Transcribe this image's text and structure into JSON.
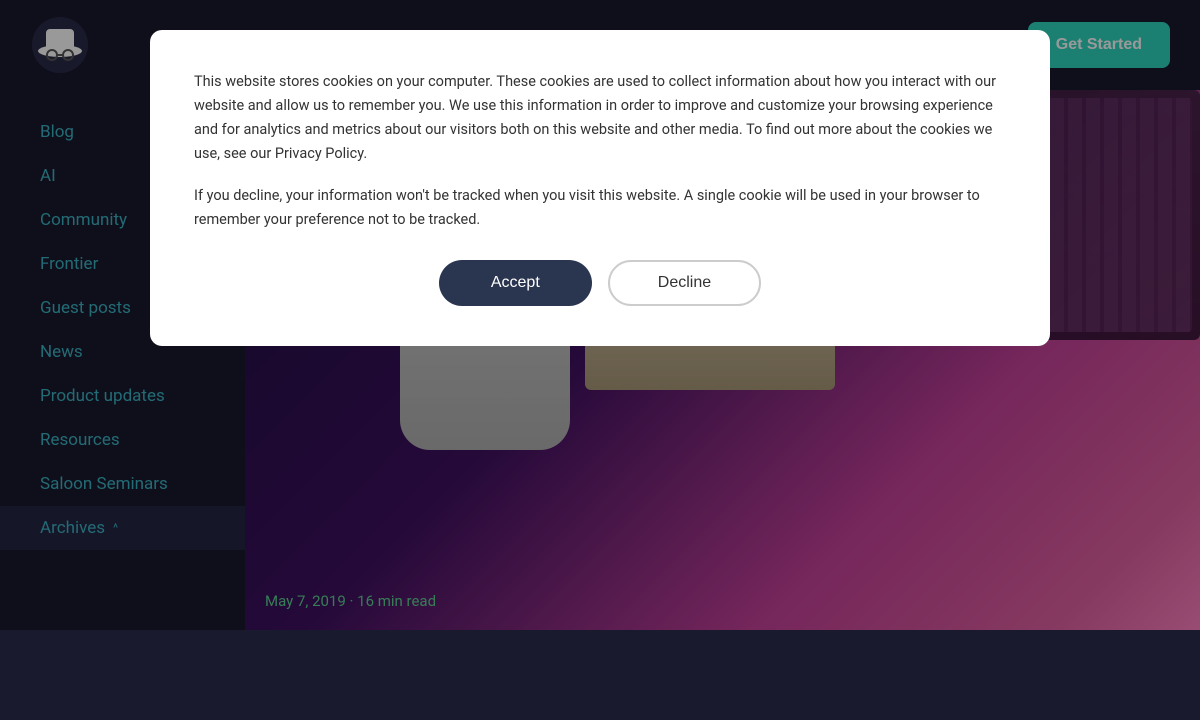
{
  "header": {
    "get_started_label": "Get Started"
  },
  "sidebar": {
    "items": [
      {
        "id": "blog",
        "label": "Blog"
      },
      {
        "id": "ai",
        "label": "AI"
      },
      {
        "id": "community",
        "label": "Community"
      },
      {
        "id": "frontier",
        "label": "Frontier"
      },
      {
        "id": "guest-posts",
        "label": "Guest posts"
      },
      {
        "id": "news",
        "label": "News"
      },
      {
        "id": "product-updates",
        "label": "Product updates"
      },
      {
        "id": "resources",
        "label": "Resources"
      },
      {
        "id": "saloon-seminars",
        "label": "Saloon Seminars"
      }
    ],
    "archives_label": "Archives",
    "archives_chevron": "^"
  },
  "main": {
    "post_meta": "May 7, 2019 · 16 min read"
  },
  "cookie": {
    "text1": "This website stores cookies on your computer. These cookies are used to collect information about how you interact with our website and allow us to remember you. We use this information in order to improve and customize your browsing experience and for analytics and metrics about our visitors both on this website and other media. To find out more about the cookies we use, see our Privacy Policy.",
    "text2": "If you decline, your information won't be tracked when you visit this website. A single cookie will be used in your browser to remember your preference not to be tracked.",
    "accept_label": "Accept",
    "decline_label": "Decline"
  }
}
